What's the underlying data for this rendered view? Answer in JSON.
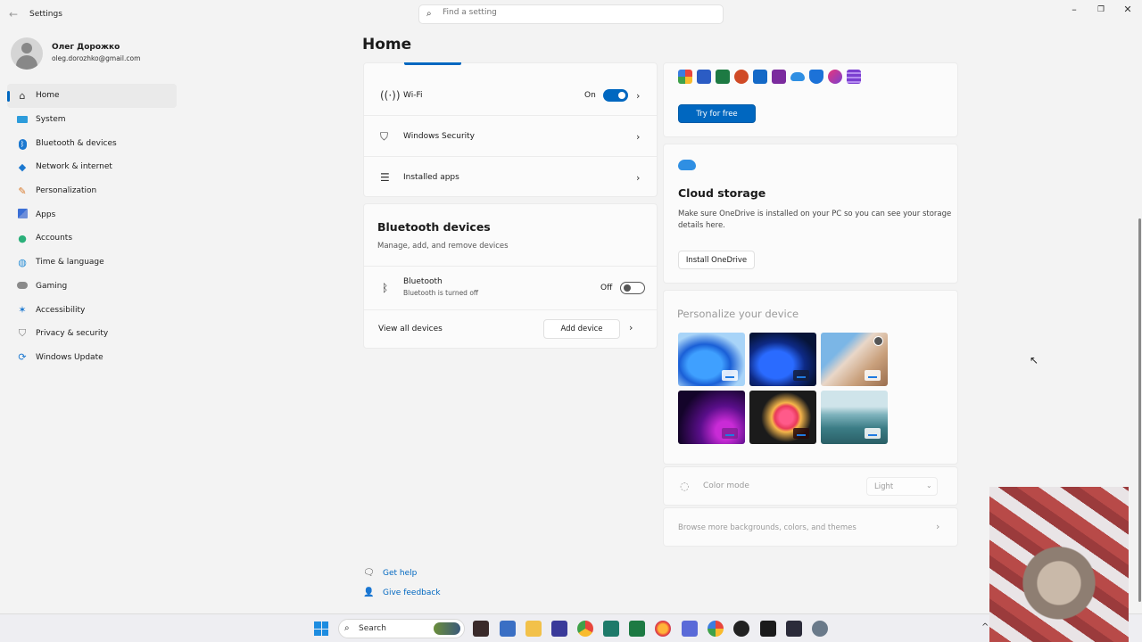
{
  "window": {
    "app_title": "Settings",
    "search_placeholder": "Find a setting"
  },
  "profile": {
    "name": "Олег Дорожко",
    "email": "oleg.dorozhko@gmail.com"
  },
  "nav": [
    {
      "label": "Home",
      "icon": "home-icon",
      "active": true
    },
    {
      "label": "System",
      "icon": "monitor-icon"
    },
    {
      "label": "Bluetooth & devices",
      "icon": "bluetooth-icon"
    },
    {
      "label": "Network & internet",
      "icon": "wifi-diamond-icon"
    },
    {
      "label": "Personalization",
      "icon": "brush-icon"
    },
    {
      "label": "Apps",
      "icon": "apps-icon"
    },
    {
      "label": "Accounts",
      "icon": "person-icon"
    },
    {
      "label": "Time & language",
      "icon": "globe-clock-icon"
    },
    {
      "label": "Gaming",
      "icon": "gamepad-icon"
    },
    {
      "label": "Accessibility",
      "icon": "accessibility-icon"
    },
    {
      "label": "Privacy & security",
      "icon": "shield-icon"
    },
    {
      "label": "Windows Update",
      "icon": "update-icon"
    }
  ],
  "page_title": "Home",
  "quick": {
    "wifi_label": "Wi-Fi",
    "wifi_state": "On",
    "security_label": "Windows Security",
    "apps_label": "Installed apps"
  },
  "bluetooth_card": {
    "title": "Bluetooth devices",
    "subtitle": "Manage, add, and remove devices",
    "bt_label": "Bluetooth",
    "bt_sub": "Bluetooth is turned off",
    "bt_state": "Off",
    "view_all": "View all devices",
    "add_device": "Add device"
  },
  "m365": {
    "try_button": "Try for free"
  },
  "cloud": {
    "title": "Cloud storage",
    "description_1": "Make sure OneDrive is installed on your PC so you can see your storage",
    "description_2": "details here.",
    "button": "Install OneDrive"
  },
  "personalize": {
    "title": "Personalize your device",
    "color_mode_label": "Color mode",
    "color_mode_value": "Light",
    "browse_more": "Browse more backgrounds, colors, and themes"
  },
  "help": {
    "get_help": "Get help",
    "give_feedback": "Give feedback"
  },
  "taskbar": {
    "search_label": "Search"
  },
  "colors": {
    "accent": "#0067c0",
    "background": "#f3f3f3",
    "card": "#fbfbfb"
  }
}
